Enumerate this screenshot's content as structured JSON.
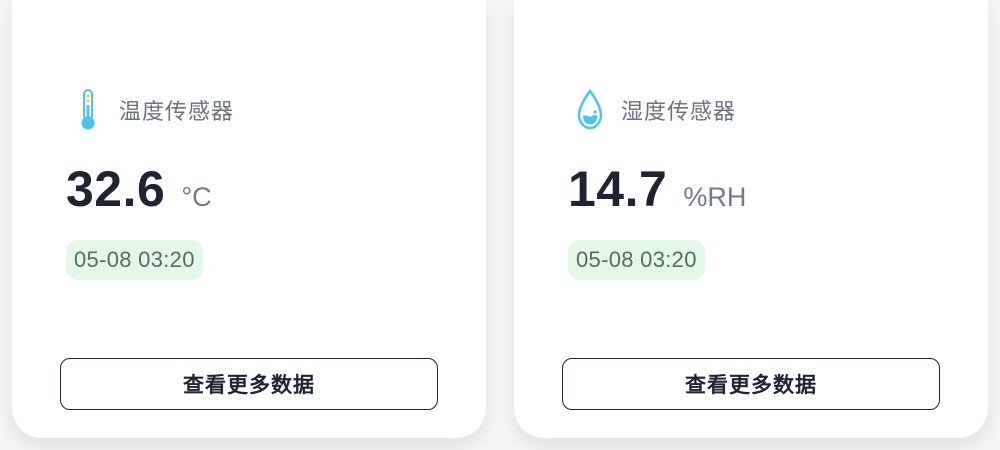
{
  "cards": [
    {
      "icon": "thermometer-icon",
      "title": "温度传感器",
      "value": "32.6",
      "unit": "°C",
      "timestamp": "05-08 03:20",
      "button_label": "查看更多数据"
    },
    {
      "icon": "water-drop-icon",
      "title": "湿度传感器",
      "value": "14.7",
      "unit": "%RH",
      "timestamp": "05-08 03:20",
      "button_label": "查看更多数据"
    }
  ],
  "colors": {
    "icon_blue": "#4cc3ea",
    "text_dark": "#1f2433",
    "text_muted": "#6b7280",
    "timestamp_bg": "#e3f8e7",
    "thermo_accent": "#f3c34a"
  }
}
